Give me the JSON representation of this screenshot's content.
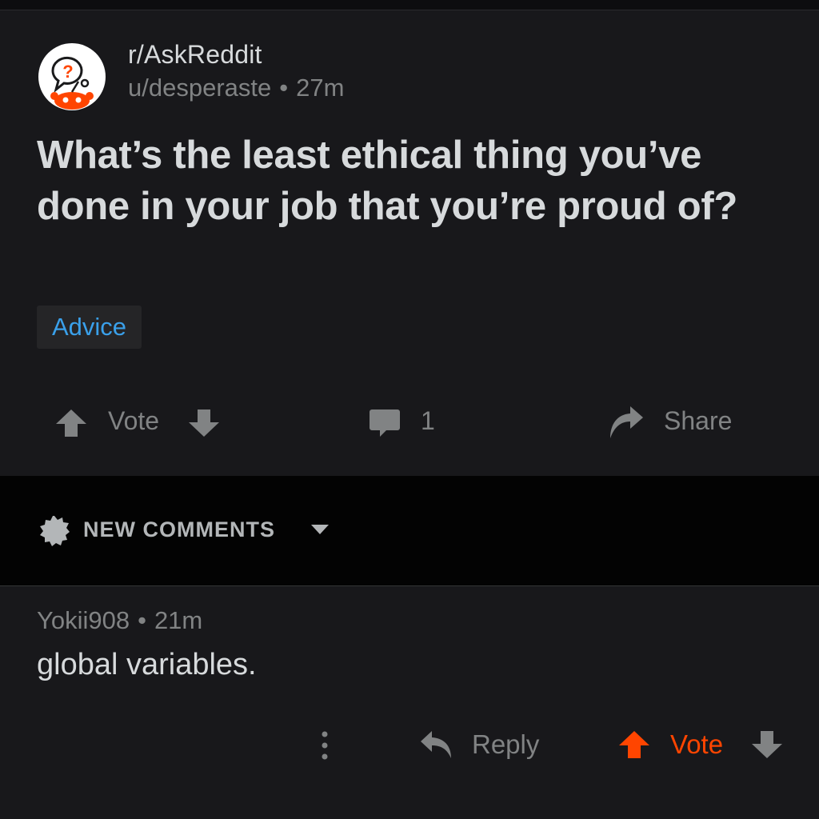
{
  "post": {
    "subreddit": "r/AskReddit",
    "author": "u/desperaste",
    "separator": "•",
    "age": "27m",
    "title": "What’s the least ethical thing you’ve done in your job that you’re proud of?",
    "flair": "Advice",
    "avatar_icon": "askreddit-snoo-icon"
  },
  "actions": {
    "vote_label": "Vote",
    "comment_count": "1",
    "share_label": "Share",
    "upvote_icon": "arrow-up-icon",
    "downvote_icon": "arrow-down-icon",
    "comment_icon": "comment-bubble-icon",
    "share_icon": "share-arrow-icon"
  },
  "comments_header": {
    "sort_label": "NEW COMMENTS",
    "sort_icon": "new-badge-icon",
    "caret_icon": "caret-down-icon"
  },
  "comment": {
    "author": "Yokii908",
    "separator": "•",
    "age": "21m",
    "body": "global variables.",
    "reply_label": "Reply",
    "vote_label": "Vote",
    "more_icon": "more-vertical-icon",
    "reply_icon": "reply-arrow-icon"
  },
  "colors": {
    "background": "#18181b",
    "text": "#d7dadc",
    "muted": "#818384",
    "flair_text": "#3aa0ea",
    "upvote_active": "#ff4500"
  }
}
